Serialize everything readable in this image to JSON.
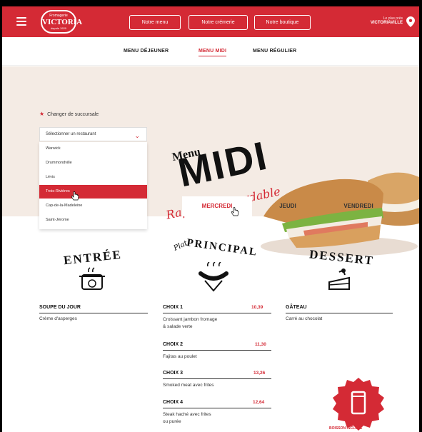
{
  "header": {
    "logo_line1": "Fromagerie",
    "logo_line2": "VICTORIA",
    "logo_line3": "depuis 1929",
    "nav": [
      "Notre menu",
      "Notre crémerie",
      "Notre boutique"
    ],
    "location_small": "Le plus près",
    "location_city": "VICTORIAVILLE"
  },
  "submenu": [
    "MENU DÉJEUNER",
    "MENU MIDI",
    "MENU RÉGULIER"
  ],
  "hero": {
    "menu_word": "Menu",
    "midi_word": "MIDI",
    "tagline": "Rapide & abordable"
  },
  "branch": {
    "label": "Changer de succursale",
    "select_placeholder": "Sélectionner un restaurant",
    "options": [
      "Warwick",
      "Drummondville",
      "Lévis",
      "Trois-Rivières",
      "Cap-de-la-Madeleine",
      "Saint-Jérome"
    ],
    "selected_index": 3
  },
  "days": [
    "MERCREDI",
    "JEUDI",
    "VENDREDI"
  ],
  "sections": {
    "entree_title": "ENTRÉE",
    "principal_small": "Plat",
    "principal_title": "PRINCIPAL",
    "dessert_title": "DESSERT"
  },
  "entree": {
    "name": "SOUPE DU JOUR",
    "desc": "Crème d'asperges"
  },
  "dessert": {
    "name": "GÂTEAU",
    "desc": "Carré au chocolat"
  },
  "choices": [
    {
      "name": "CHOIX 1",
      "price": "10,39",
      "desc1": "Croissant jambon fromage",
      "desc2": "& salade verte"
    },
    {
      "name": "CHOIX 2",
      "price": "11,30",
      "desc1": "Fajitas au poulet",
      "desc2": ""
    },
    {
      "name": "CHOIX 3",
      "price": "13,26",
      "desc1": "Smoked meat avec frites",
      "desc2": ""
    },
    {
      "name": "CHOIX 4",
      "price": "12,64",
      "desc1": "Steak haché avec frites",
      "desc2": "ou purée"
    }
  ],
  "badge_text": "BOISSON INCLUSE",
  "colors": {
    "brand_red": "#d42a35",
    "hero_bg": "#f4ebe4"
  }
}
